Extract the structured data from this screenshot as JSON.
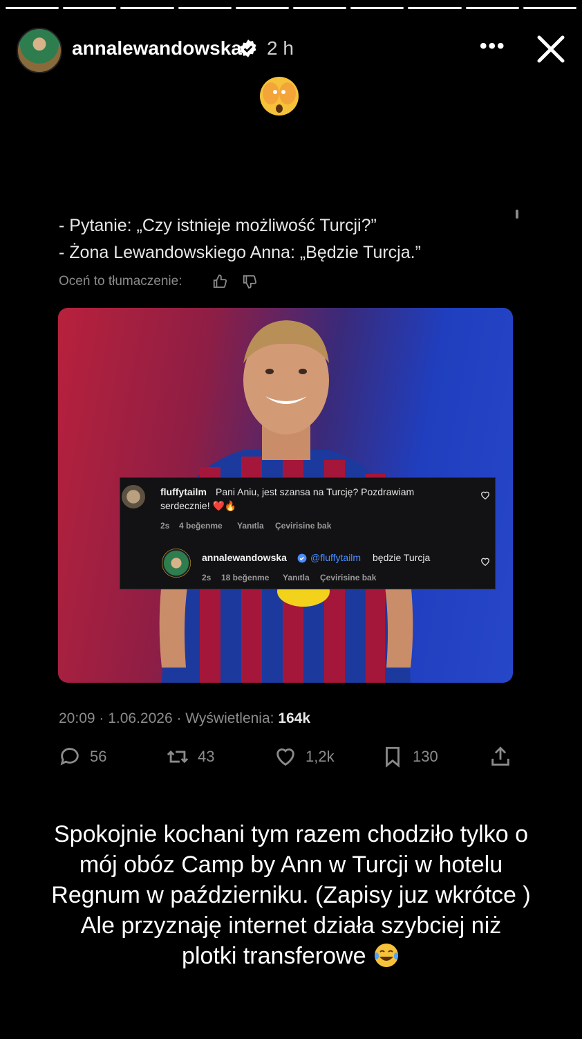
{
  "story": {
    "progress_segments": 10,
    "progress_active": 10,
    "username": "annalewandowska",
    "time_ago": "2 h",
    "more_label": "•••"
  },
  "tweet": {
    "line1": "- Pytanie: „Czy istnieje możliwość Turcji?”",
    "line2": "- Żona Lewandowskiego Anna: „Będzie Turcja.”",
    "rate_label": "Oceń to tłumaczenie:",
    "timestamp": "20:09 · 1.06.2026 · Wyświetlenia:",
    "views": "164k",
    "replies": "56",
    "retweets": "43",
    "likes": "1,2k",
    "bookmarks": "130"
  },
  "embedded_comments": {
    "c1": {
      "user": "fluffytailm",
      "text1": "Pani Aniu, jest szansa na Turcję? Pozdrawiam",
      "text2": "serdecznie! ❤️🔥",
      "time": "2s",
      "likes": "4 beğenme",
      "reply": "Yanıtla",
      "translate": "Çevirisine bak"
    },
    "c2": {
      "user": "annalewandowska",
      "mention": "@fluffytailm",
      "text": "będzie Turcja",
      "time": "2s",
      "likes": "18 beğenme",
      "reply": "Yanıtla",
      "translate": "Çevirisine bak"
    }
  },
  "caption": {
    "line1": "Spokojnie kochani tym razem chodziło tylko o",
    "line2": "mój obóz Camp by Ann w Turcji w hotelu",
    "line3": "Regnum w październiku. (Zapisy juz wkrótce )",
    "line4": "Ale przyznaję internet działa szybciej niż",
    "line5": "plotki transferowe"
  },
  "colors": {
    "verified": "#ffffff",
    "link_blue": "#4c8dff",
    "muted": "#8b8b8b"
  }
}
